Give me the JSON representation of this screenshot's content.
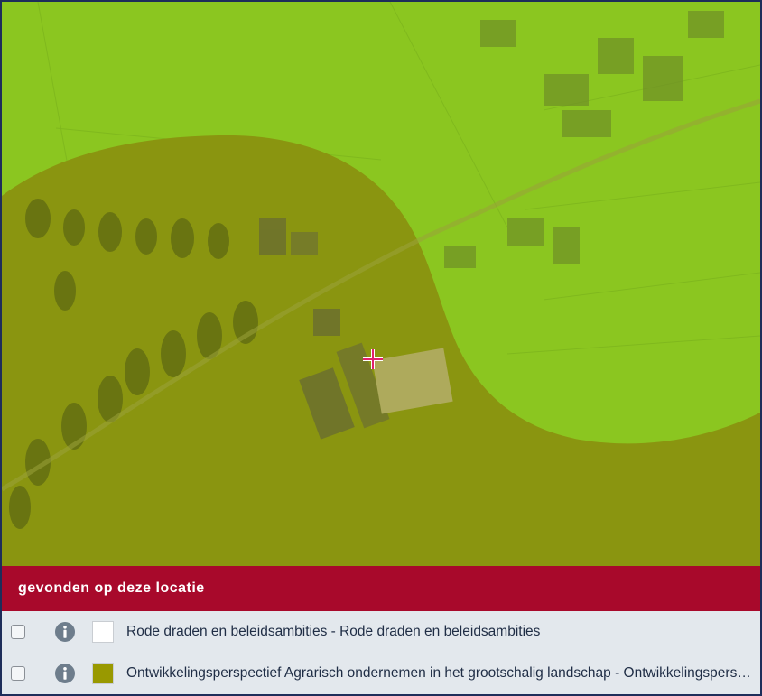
{
  "panel": {
    "title": "gevonden op deze locatie"
  },
  "layers": [
    {
      "label": "Rode draden en beleidsambities - Rode draden en beleidsambities",
      "swatch_color": "#ffffff",
      "checked": false
    },
    {
      "label": "Ontwikkelingsperspectief Agrarisch ondernemen in het grootschalig landschap - Ontwikkelingsperspectief Agrarisch ondernemen in het grootschalig landschap",
      "swatch_color": "#999900",
      "checked": false
    }
  ],
  "map": {
    "overlay_light_color": "#8fcc1a",
    "overlay_dark_color": "#8a9a10",
    "marker_color": "#e0216e",
    "marker_icon": "crosshair-icon"
  }
}
